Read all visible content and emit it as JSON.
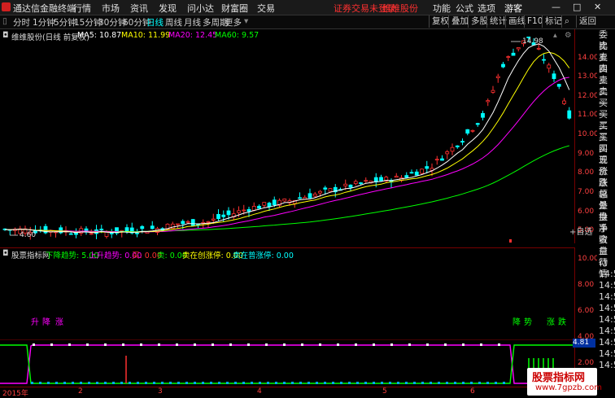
{
  "titlebar": {
    "app": "通达信金融终端",
    "menus": [
      "行情",
      "市场",
      "资讯",
      "发现",
      "问小达",
      "财富圈",
      "交易"
    ],
    "notice": "证券交易未登录",
    "stock_tab": "维维股份",
    "right": [
      "功能",
      "公式",
      "选项"
    ],
    "user": "游客"
  },
  "periods": [
    "分时",
    "1分钟",
    "5分钟",
    "15分钟",
    "30分钟",
    "60分钟",
    "日线",
    "周线",
    "月线",
    "多周期",
    "更多"
  ],
  "tools": [
    "复权",
    "叠加",
    "多股",
    "统计",
    "画线",
    "F10",
    "标记",
    "返回"
  ],
  "chart": {
    "stock_label": "维维股份(日线 前复权)",
    "ma5": "MA5: 10.87",
    "ma10": "MA10: 11.99",
    "ma20": "MA20: 12.45",
    "ma60": "MA60: 9.57",
    "high_label": "14.98",
    "low_label": "4.60",
    "y_labels": [
      "14.00",
      "13.00",
      "12.00",
      "11.00",
      "10.00",
      "9.00",
      "8.00",
      "7.00",
      "6.00",
      "5.00"
    ],
    "colors": {
      "ma5": "#ffffff",
      "ma10": "#ffff00",
      "ma20": "#ff00ff",
      "ma60": "#00ff00",
      "up": "#ff3030",
      "down": "#00ffff"
    }
  },
  "indicator": {
    "name": "股票指标网",
    "fields": [
      "下降趋势: 5.00",
      "上升趋势: 0.00",
      "买: 0.00",
      "卖: 0.00",
      "卖在创涨停: 0.00",
      "卖在普涨停: 0.00"
    ],
    "marks_left": [
      "升",
      "降",
      "涨"
    ],
    "marks_right": [
      "降",
      "势",
      "涨",
      "跌"
    ],
    "y_labels": [
      "10.00",
      "8.00",
      "6.00",
      "4.00",
      "2.00"
    ],
    "current": "4.81"
  },
  "dates": [
    "2015年",
    "2",
    "3",
    "4",
    "5",
    "6"
  ],
  "right_panel": [
    "委比",
    "卖五",
    "卖四",
    "卖三",
    "卖二",
    "卖一",
    "买一",
    "买二",
    "买三",
    "买四",
    "买五",
    "现价",
    "涨跌",
    "涨幅",
    "总量",
    "外盘",
    "换手",
    "净资",
    "收益",
    "自动",
    "行情",
    "14:5",
    "14:5",
    "14:5",
    "14:5",
    "14:5",
    "14:5",
    "14:5",
    "14:5",
    "14:5"
  ],
  "self_select": "+自选",
  "watermark": {
    "line1": "股票指标网",
    "line2": "www.7gpzb.com"
  }
}
